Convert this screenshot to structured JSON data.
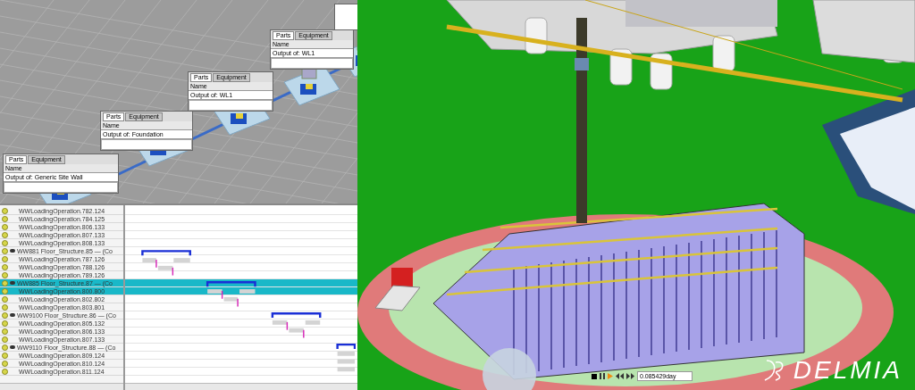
{
  "flow_view": {
    "cards": [
      {
        "tabs": [
          {
            "label": "Parts",
            "selected": true
          },
          {
            "label": "Equipment",
            "selected": false
          }
        ],
        "name_label": "Name",
        "output": "Output of: Generic Site Wall"
      },
      {
        "tabs": [
          {
            "label": "Parts",
            "selected": true
          },
          {
            "label": "Equipment",
            "selected": false
          }
        ],
        "name_label": "Name",
        "output": "Output of: Foundation"
      },
      {
        "tabs": [
          {
            "label": "Parts",
            "selected": true
          },
          {
            "label": "Equipment",
            "selected": false
          }
        ],
        "name_label": "Name",
        "output": "Output of: WL1"
      },
      {
        "tabs": [
          {
            "label": "Parts",
            "selected": true
          },
          {
            "label": "Equipment",
            "selected": false
          }
        ],
        "name_label": "Name",
        "output": "Output of: WL1"
      }
    ]
  },
  "gantt": {
    "rows": [
      {
        "kind": "operation",
        "label": "WWLoadingOperation.782.124",
        "selected": false
      },
      {
        "kind": "operation",
        "label": "WWLoadingOperation.784.125",
        "selected": false
      },
      {
        "kind": "operation",
        "label": "WWLoadingOperation.806.133",
        "selected": false
      },
      {
        "kind": "operation",
        "label": "WWLoadingOperation.807.133",
        "selected": false
      },
      {
        "kind": "operation",
        "label": "WWLoadingOperation.808.133",
        "selected": false
      },
      {
        "kind": "group",
        "label": "WW881 Floor_Structure.85 — (Co",
        "selected": false
      },
      {
        "kind": "operation",
        "label": "WWLoadingOperation.787.126",
        "selected": false
      },
      {
        "kind": "operation",
        "label": "WWLoadingOperation.788.126",
        "selected": false
      },
      {
        "kind": "operation",
        "label": "WWLoadingOperation.789.126",
        "selected": false
      },
      {
        "kind": "group",
        "label": "WW885 Floor_Structure.87 — (Co",
        "selected": true
      },
      {
        "kind": "operation",
        "label": "WWLoadingOperation.800.800",
        "selected": true
      },
      {
        "kind": "operation",
        "label": "WWLoadingOperation.802.802",
        "selected": false
      },
      {
        "kind": "operation",
        "label": "WWLoadingOperation.803.801",
        "selected": false
      },
      {
        "kind": "group",
        "label": "WW9100 Floor_Structure.86 — (Co",
        "selected": false
      },
      {
        "kind": "operation",
        "label": "WWLoadingOperation.805.132",
        "selected": false
      },
      {
        "kind": "operation",
        "label": "WWLoadingOperation.806.133",
        "selected": false
      },
      {
        "kind": "operation",
        "label": "WWLoadingOperation.807.133",
        "selected": false
      },
      {
        "kind": "group",
        "label": "WW9110 Floor_Structure.88 — (Co",
        "selected": false
      },
      {
        "kind": "operation",
        "label": "WWLoadingOperation.809.124",
        "selected": false
      },
      {
        "kind": "operation",
        "label": "WWLoadingOperation.810.124",
        "selected": false
      },
      {
        "kind": "operation",
        "label": "WWLoadingOperation.811.124",
        "selected": false
      }
    ]
  },
  "scene": {
    "time_value": "0.085429day",
    "logo": "DELMIA"
  }
}
